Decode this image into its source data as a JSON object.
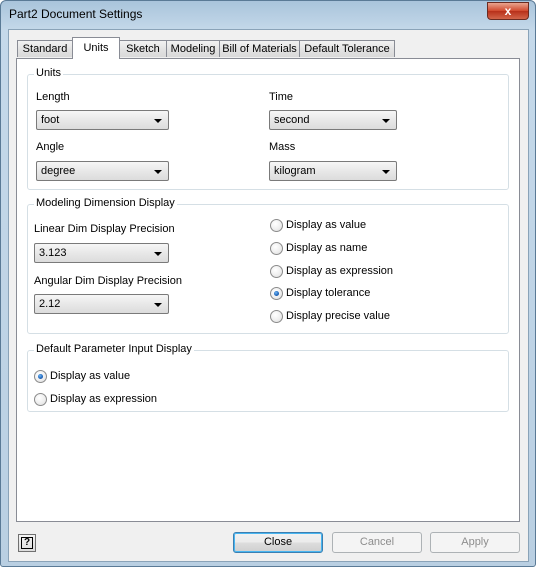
{
  "window": {
    "title": "Part2 Document Settings",
    "close_glyph": "x"
  },
  "tabs": [
    {
      "label": "Standard",
      "active": false
    },
    {
      "label": "Units",
      "active": true
    },
    {
      "label": "Sketch",
      "active": false
    },
    {
      "label": "Modeling",
      "active": false
    },
    {
      "label": "Bill of Materials",
      "active": false
    },
    {
      "label": "Default Tolerance",
      "active": false
    }
  ],
  "units": {
    "group_label": "Units",
    "length_label": "Length",
    "length_value": "foot",
    "time_label": "Time",
    "time_value": "second",
    "angle_label": "Angle",
    "angle_value": "degree",
    "mass_label": "Mass",
    "mass_value": "kilogram"
  },
  "modeling_display": {
    "group_label": "Modeling Dimension Display",
    "linear_label": "Linear Dim Display Precision",
    "linear_value": "3.123",
    "angular_label": "Angular Dim Display Precision",
    "angular_value": "2.12",
    "options": [
      {
        "label": "Display as value",
        "checked": false
      },
      {
        "label": "Display as name",
        "checked": false
      },
      {
        "label": "Display as expression",
        "checked": false
      },
      {
        "label": "Display tolerance",
        "checked": true
      },
      {
        "label": "Display precise value",
        "checked": false
      }
    ]
  },
  "parameter_input": {
    "group_label": "Default Parameter Input Display",
    "options": [
      {
        "label": "Display as value",
        "checked": true
      },
      {
        "label": "Display as expression",
        "checked": false
      }
    ]
  },
  "footer": {
    "help_glyph": "?",
    "close_label": "Close",
    "cancel_label": "Cancel",
    "apply_label": "Apply"
  },
  "colors": {
    "accent": "#3c7fb1",
    "radio_selected": "#1d63b8",
    "close_button": "#d0482d"
  }
}
